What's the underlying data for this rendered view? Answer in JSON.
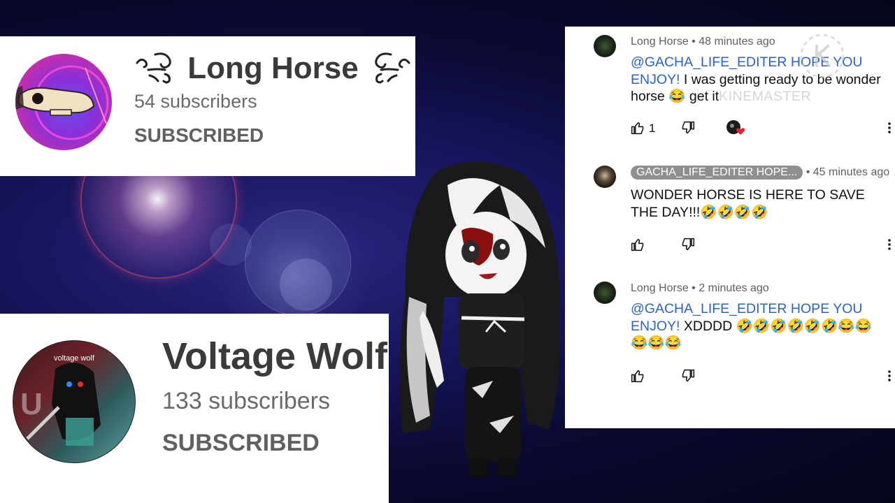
{
  "channels": [
    {
      "name": "Long Horse",
      "subscribers": "54 subscribers",
      "status": "SUBSCRIBED"
    },
    {
      "name": "Voltage Wolf",
      "avatar_caption": "voltage wolf",
      "subscribers": "133 subscribers",
      "status": "SUBSCRIBED"
    }
  ],
  "comments": [
    {
      "author": "Long Horse",
      "time": "• 48 minutes ago",
      "mention": "@GACHA_LIFE_EDITER HOPE YOU ENJOY!",
      "text": " I was getting ready to be wonder horse 😂 get it",
      "watermark": "KINEMASTER",
      "like_count": "1",
      "heart": true
    },
    {
      "author": "GACHA_LIFE_EDITER HOPE...",
      "time": "• 45 minutes ago",
      "mention": "",
      "text": "WONDER HORSE IS HERE TO SAVE THE DAY!!!🤣🤣🤣🤣",
      "like_count": ""
    },
    {
      "author": "Long Horse",
      "time": "• 2 minutes ago",
      "mention": "@GACHA_LIFE_EDITER HOPE YOU ENJOY!",
      "text": " XDDDD 🤣🤣🤣🤣🤣🤣😂😂😂😂😂",
      "like_count": ""
    }
  ],
  "colors": {
    "mention": "#2a63c8",
    "pill": "#8f8f8f",
    "subscribed_text": "#606060",
    "background_deep": "#0b0a33"
  },
  "icons": [
    "swirl-icon",
    "thumbs-up-icon",
    "thumbs-down-icon",
    "more-vert-icon",
    "heart-icon",
    "kinemaster-logo"
  ]
}
